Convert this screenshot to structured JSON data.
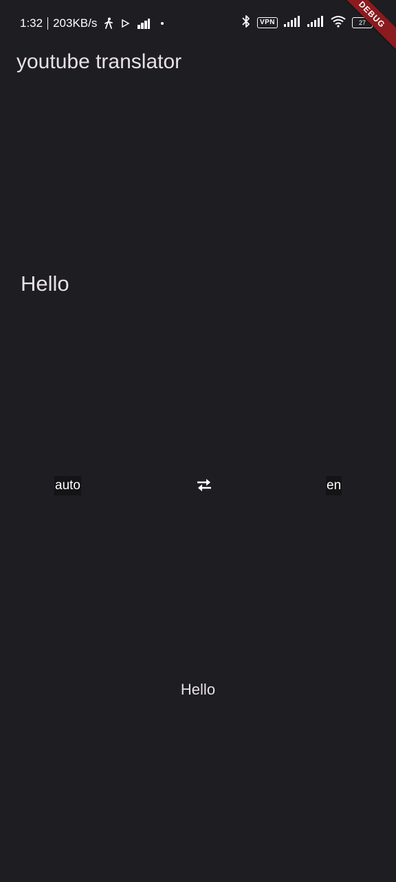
{
  "status_bar": {
    "time": "1:32",
    "speed": "203KB/s",
    "vpn": "VPN",
    "battery": "27"
  },
  "debug_banner": "DEBUG",
  "app_bar": {
    "title": "youtube translator"
  },
  "input": {
    "value": "Hello"
  },
  "languages": {
    "source": "auto",
    "target": "en"
  },
  "output": {
    "text": "Hello"
  },
  "colors": {
    "background": "#1e1d22",
    "text": "#e6e1e5",
    "debug_ribbon": "#8b1b1f"
  },
  "icons": {
    "swap": "swap-horiz-icon"
  }
}
